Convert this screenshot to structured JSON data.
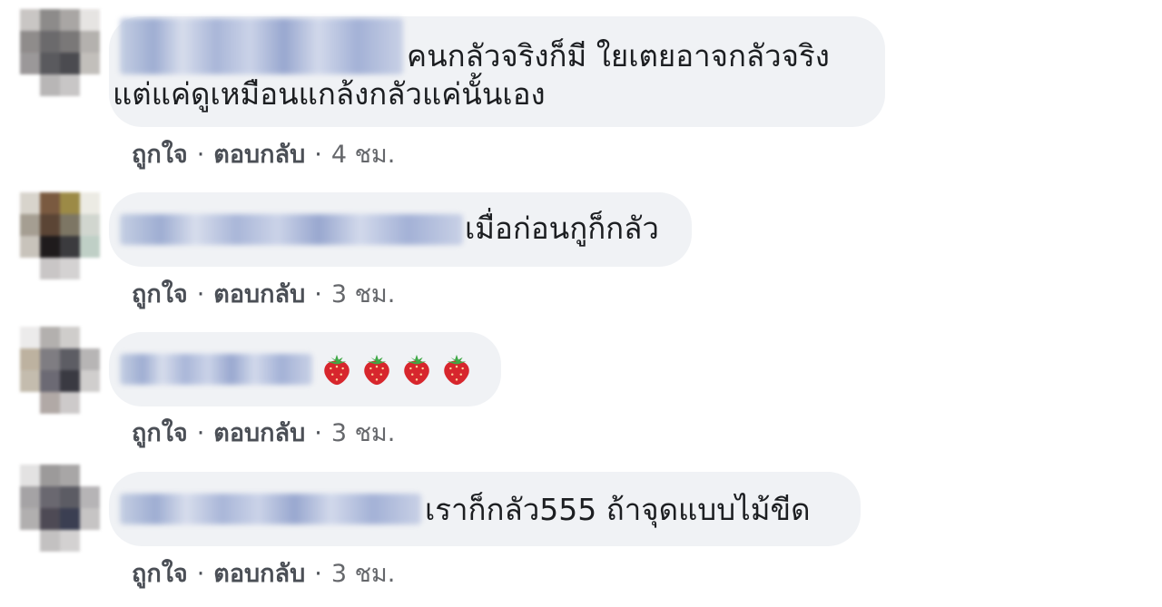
{
  "comments": [
    {
      "text_line1": "คนกลัวจริงก็มี ใยเตยอาจกลัวจริง",
      "text_line2": "แต่แค่ดูเหมือนแกล้งกลัวแค่นั้นเอง",
      "like": "ถูกใจ",
      "reply": "ตอบกลับ",
      "time": "4 ชม.",
      "separator": "·"
    },
    {
      "text_line1": "เมื่อก่อนกูก็กลัว",
      "like": "ถูกใจ",
      "reply": "ตอบกลับ",
      "time": "3 ชม.",
      "separator": "·"
    },
    {
      "emoji_icon": "strawberry-icon",
      "emoji_count": 4,
      "like": "ถูกใจ",
      "reply": "ตอบกลับ",
      "time": "3 ชม.",
      "separator": "·"
    },
    {
      "text_line1": "เราก็กลัว555 ถ้าจุดแบบไม้ขีด",
      "like": "ถูกใจ",
      "reply": "ตอบกลับ",
      "time": "3 ชม.",
      "separator": "·"
    }
  ],
  "colors": {
    "bubble": "#f0f2f5",
    "text": "#1c1e21",
    "actions": "#4b4f56",
    "strawberry": "#d7262d"
  }
}
